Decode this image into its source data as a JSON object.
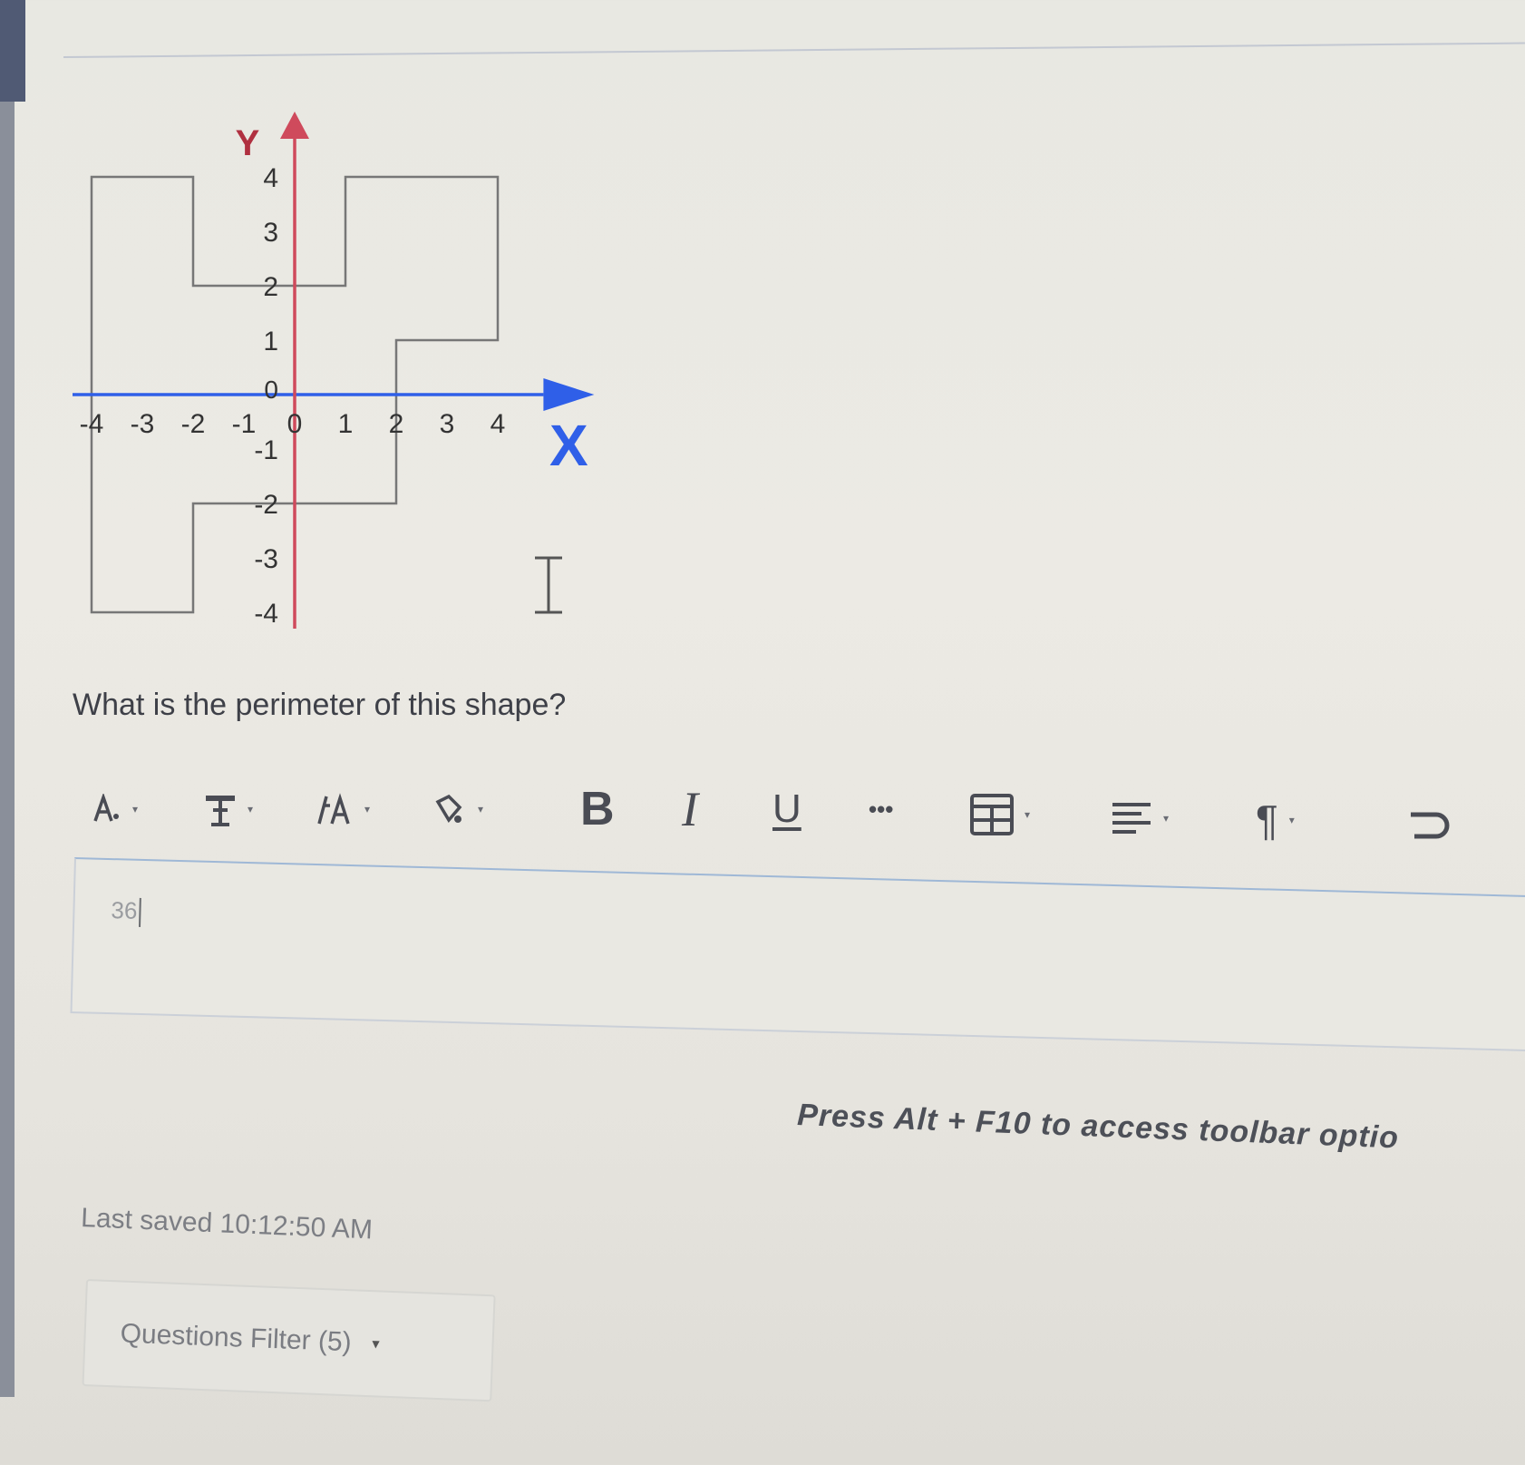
{
  "graph": {
    "x_axis_label": "X",
    "y_axis_label": "Y",
    "origin_label": "0",
    "x_ticks": [
      "-4",
      "-3",
      "-2",
      "-1",
      "0",
      "1",
      "2",
      "3",
      "4"
    ],
    "y_ticks": [
      "4",
      "3",
      "2",
      "1",
      "-1",
      "-2",
      "-3",
      "-4"
    ],
    "shape_vertices": [
      [
        -4,
        4
      ],
      [
        -2,
        4
      ],
      [
        -2,
        2
      ],
      [
        1,
        2
      ],
      [
        1,
        4
      ],
      [
        4,
        4
      ],
      [
        4,
        1
      ],
      [
        2,
        1
      ],
      [
        2,
        -2
      ],
      [
        -2,
        -2
      ],
      [
        -2,
        -4
      ],
      [
        -4,
        -4
      ]
    ],
    "colors": {
      "x_axis": "#2f5fe8",
      "y_axis": "#cf4a5c",
      "shape": "#777777"
    }
  },
  "question": {
    "text": "What is the perimeter of this shape?"
  },
  "toolbar": {
    "items": [
      {
        "icon": "font-family-icon"
      },
      {
        "icon": "text-style-icon"
      },
      {
        "icon": "font-size-icon"
      },
      {
        "icon": "text-color-icon"
      },
      {
        "icon": "bold-icon",
        "label": "B"
      },
      {
        "icon": "italic-icon",
        "label": "I"
      },
      {
        "icon": "underline-icon",
        "label": "U"
      },
      {
        "icon": "more-icon",
        "label": "•••"
      },
      {
        "icon": "table-icon"
      },
      {
        "icon": "align-icon"
      },
      {
        "icon": "paragraph-icon",
        "label": "¶"
      },
      {
        "icon": "undo-icon"
      }
    ]
  },
  "editor": {
    "value": "36"
  },
  "hint": "Press Alt + F10 to access toolbar optio",
  "last_saved": "Last saved 10:12:50 AM",
  "filter": {
    "label": "Questions Filter (5)"
  }
}
